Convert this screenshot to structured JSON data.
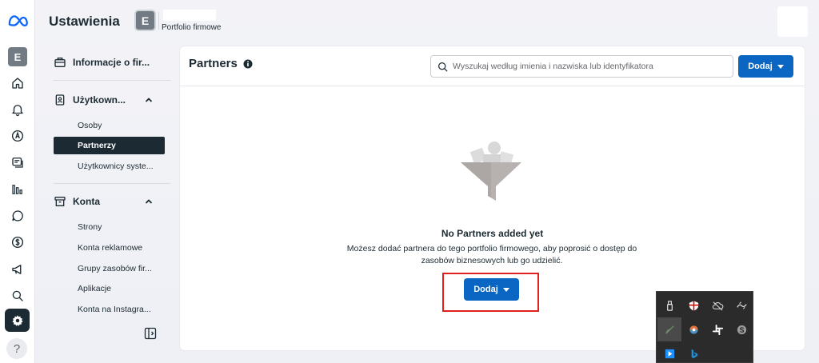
{
  "header": {
    "title": "Ustawienia",
    "portfolio_initial": "E",
    "portfolio_label": "Portfolio firmowe"
  },
  "rail": {
    "account_initial": "E",
    "help": "?"
  },
  "nav": {
    "business_info": "Informacje o fir...",
    "users_section": "Użytkown...",
    "users_items": [
      "Osoby",
      "Partnerzy",
      "Użytkownicy syste..."
    ],
    "accounts_section": "Konta",
    "accounts_items": [
      "Strony",
      "Konta reklamowe",
      "Grupy zasobów fir...",
      "Aplikacje",
      "Konta na Instagra..."
    ]
  },
  "main": {
    "title": "Partners",
    "search_placeholder": "Wyszukaj według imienia i nazwiska lub identyfikatora",
    "add_label": "Dodaj",
    "empty_title": "No Partners added yet",
    "empty_desc": "Możesz dodać partnera do tego portfolio firmowego, aby poprosić o dostęp do zasobów biznesowych lub go udzielić.",
    "empty_add_label": "Dodaj"
  },
  "colors": {
    "accent": "#0a66c2",
    "dark": "#1c2b33",
    "highlight": "#e0201c"
  }
}
